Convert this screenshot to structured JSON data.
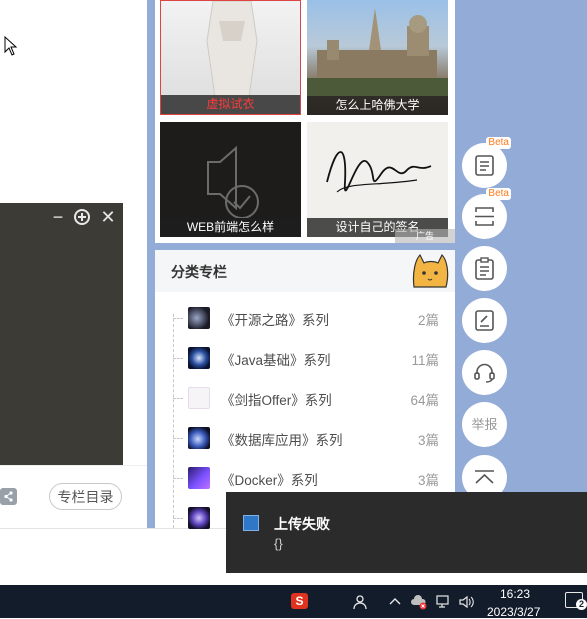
{
  "left": {
    "column_dir_label": "专栏目录"
  },
  "ads": {
    "tiles": [
      {
        "caption": "虚拟试衣"
      },
      {
        "caption": "怎么上哈佛大学"
      },
      {
        "caption": "WEB前端怎么样"
      },
      {
        "caption": "设计自己的签名"
      }
    ],
    "badge": "广告"
  },
  "categories": {
    "title": "分类专栏",
    "items": [
      {
        "name": "《开源之路》系列",
        "count": "2篇"
      },
      {
        "name": "《Java基础》系列",
        "count": "11篇"
      },
      {
        "name": "《剑指Offer》系列",
        "count": "64篇"
      },
      {
        "name": "《数据库应用》系列",
        "count": "3篇"
      },
      {
        "name": "《Docker》系列",
        "count": "3篇"
      },
      {
        "name": "",
        "count": ""
      }
    ]
  },
  "toolbar": {
    "beta": "Beta",
    "report": "举报"
  },
  "toast": {
    "title": "上传失败",
    "message": "{}"
  },
  "taskbar": {
    "time": "16:23",
    "date": "2023/3/27",
    "notification_count": "2"
  },
  "colors": {
    "page_bg": "#93abd7",
    "accent_beta": "#ff7a1a",
    "taskbar": "#121c2b"
  }
}
